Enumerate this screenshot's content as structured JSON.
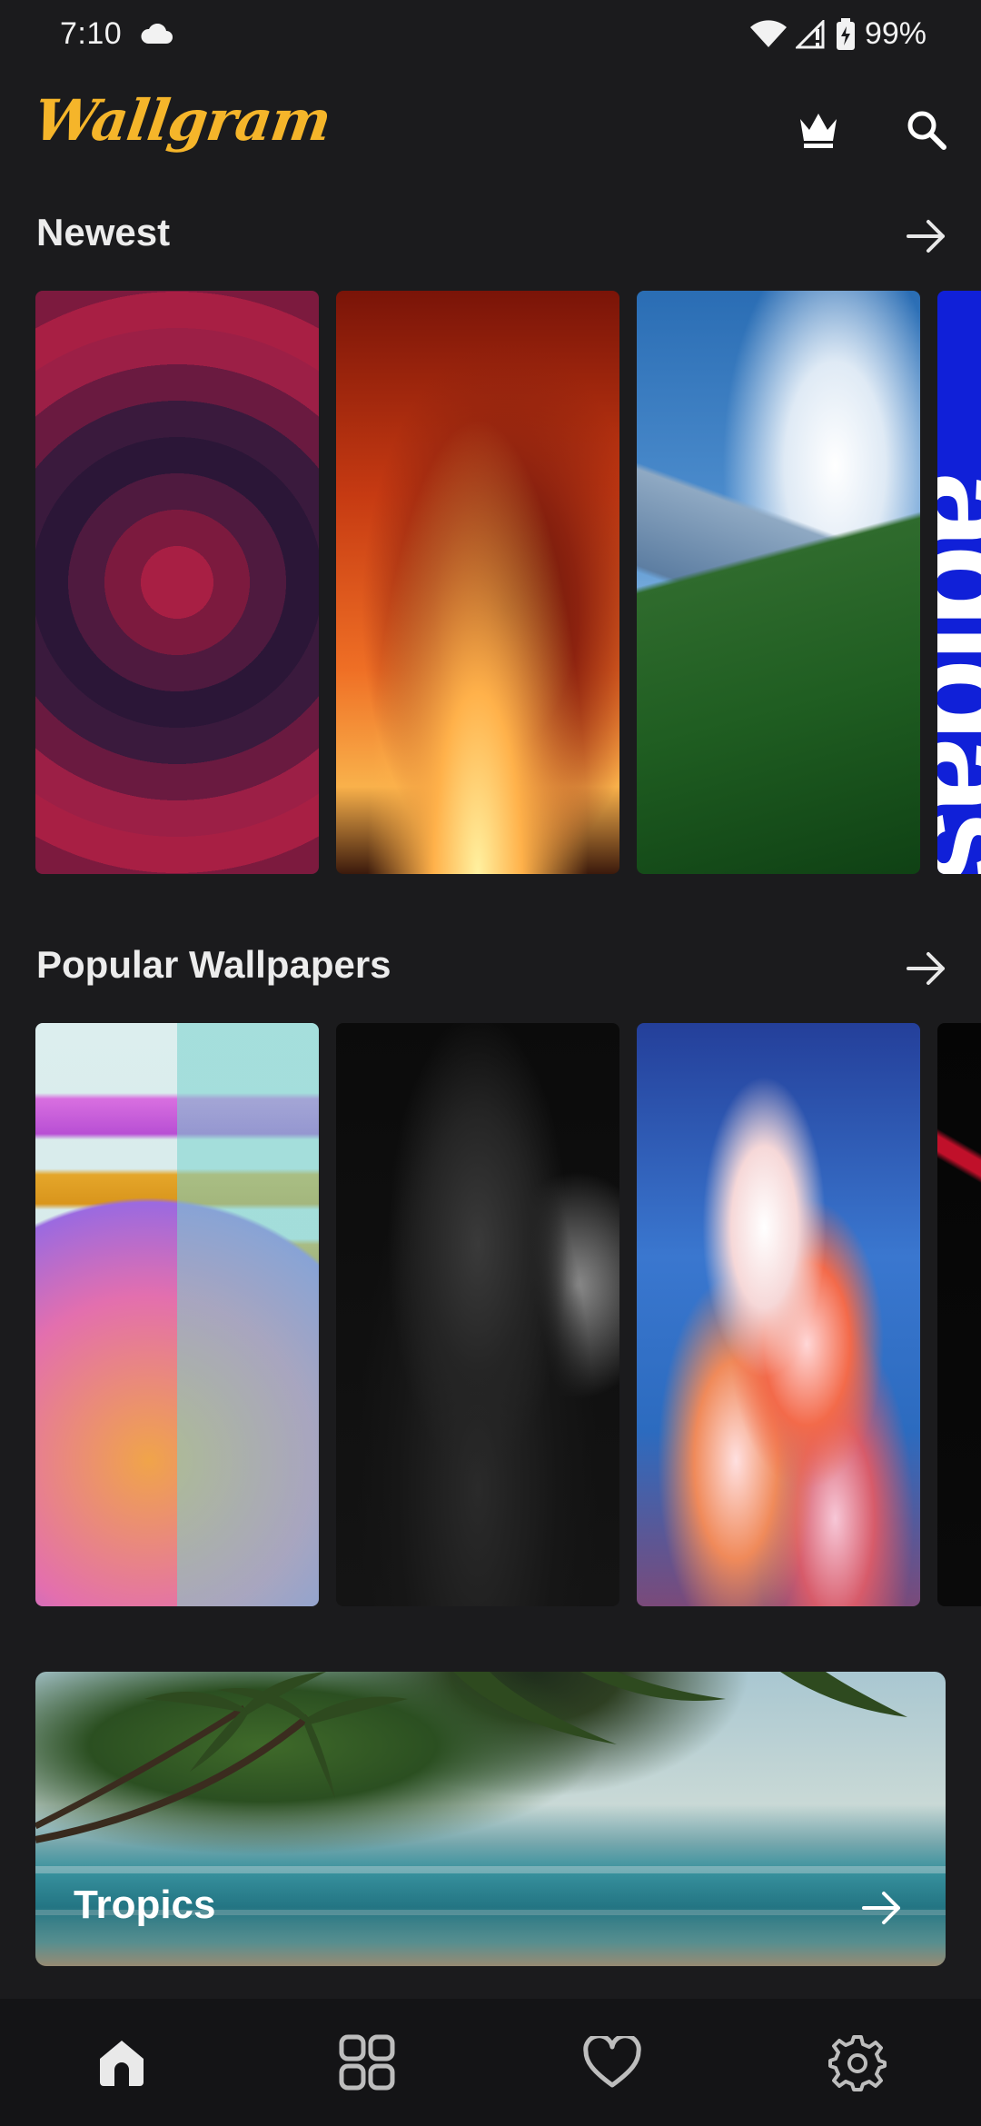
{
  "status_bar": {
    "time": "7:10",
    "battery": "99%",
    "icons": [
      "cloud-icon",
      "wifi-icon",
      "signal-icon",
      "battery-icon"
    ]
  },
  "app": {
    "logo_text": "Wallgram",
    "logo_color": "#f5b52a",
    "actions": [
      "crown-icon",
      "search-icon"
    ]
  },
  "sections": {
    "newest": {
      "title": "Newest",
      "cards": [
        {
          "art": "concentric-rings"
        },
        {
          "art": "fire-warrior"
        },
        {
          "art": "mountain-landscape"
        },
        {
          "art": "adidas",
          "text": "adidas"
        }
      ]
    },
    "popular": {
      "title": "Popular Wallpapers",
      "cards": [
        {
          "art": "glass-shapes"
        },
        {
          "art": "batman"
        },
        {
          "art": "painted-clouds"
        },
        {
          "art": "playing-cards"
        }
      ]
    }
  },
  "banner": {
    "title": "Tropics"
  },
  "bottom_nav": {
    "items": [
      "home-icon",
      "grid-icon",
      "heart-icon",
      "gear-icon"
    ],
    "active": "home-icon"
  }
}
